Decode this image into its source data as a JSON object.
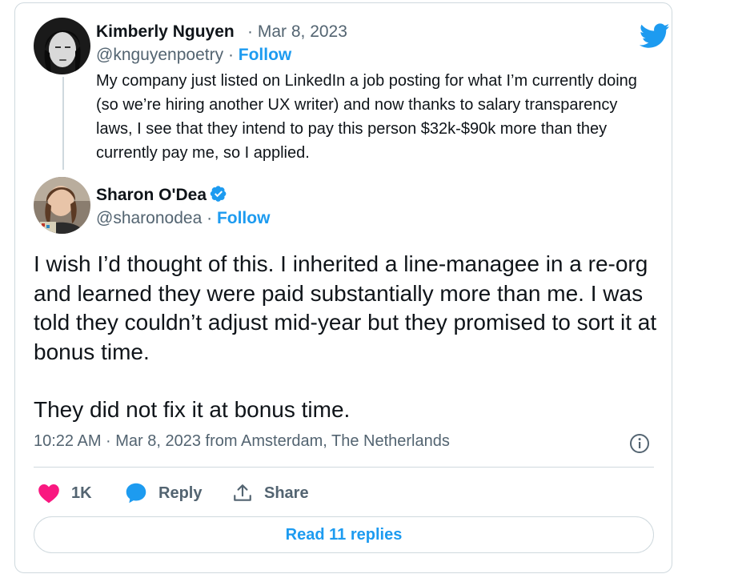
{
  "quoted": {
    "name": "Kimberly Nguyen",
    "date": "Mar 8, 2023",
    "handle": "@knguyenpoetry",
    "follow": "Follow",
    "separator": "·",
    "text": "My company just listed on LinkedIn a job posting for what I’m currently doing (so we’re hiring another UX writer) and now thanks to salary transparency laws, I see that they intend to pay this person $32k-$90k more than they currently pay me, so I applied."
  },
  "reply": {
    "name": "Sharon O'Dea",
    "handle": "@sharonodea",
    "follow": "Follow",
    "separator": "·",
    "paragraph1": "I wish I’d thought of this. I inherited a line-managee in a re-org and learned they were paid substantially more than me. I was told they couldn’t adjust mid-year but they promised to sort it at bonus time.",
    "paragraph2": "They did not fix it at bonus time.",
    "timestamp": "10:22 AM · Mar 8, 2023 from Amsterdam, The Netherlands"
  },
  "actions": {
    "likes": "1K",
    "reply": "Reply",
    "share": "Share"
  },
  "read_replies": "Read 11 replies",
  "colors": {
    "accent": "#1d9bf0",
    "like": "#f91880",
    "muted": "#536471",
    "border": "#cfd9de"
  },
  "icons": [
    "twitter-logo-icon",
    "verified-badge-icon",
    "info-icon",
    "heart-icon",
    "reply-bubble-icon",
    "share-icon"
  ]
}
